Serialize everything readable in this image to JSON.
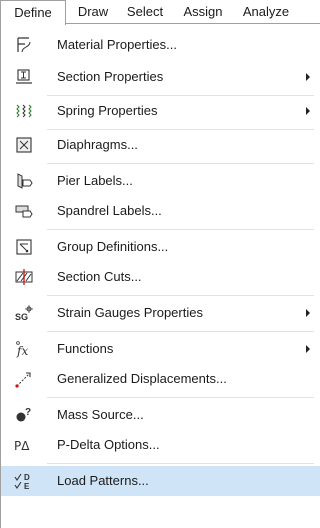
{
  "menubar": {
    "items": [
      {
        "label": "Define"
      },
      {
        "label": "Draw"
      },
      {
        "label": "Select"
      },
      {
        "label": "Assign"
      },
      {
        "label": "Analyze"
      }
    ]
  },
  "menu": {
    "items": [
      {
        "label": "Material Properties...",
        "icon": "material-properties-icon",
        "submenu": false
      },
      {
        "label": "Section Properties",
        "icon": "section-properties-icon",
        "submenu": true
      },
      {
        "label": "Spring Properties",
        "icon": "spring-properties-icon",
        "submenu": true
      },
      {
        "label": "Diaphragms...",
        "icon": "diaphragms-icon",
        "submenu": false
      },
      {
        "label": "Pier Labels...",
        "icon": "pier-labels-icon",
        "submenu": false
      },
      {
        "label": "Spandrel Labels...",
        "icon": "spandrel-labels-icon",
        "submenu": false
      },
      {
        "label": "Group Definitions...",
        "icon": "group-definitions-icon",
        "submenu": false
      },
      {
        "label": "Section Cuts...",
        "icon": "section-cuts-icon",
        "submenu": false
      },
      {
        "label": "Strain Gauges Properties",
        "icon": "strain-gauges-icon",
        "icon_text": "SG",
        "submenu": true
      },
      {
        "label": "Functions",
        "icon": "functions-icon",
        "icon_text": "fx",
        "submenu": true
      },
      {
        "label": "Generalized Displacements...",
        "icon": "generalized-displacements-icon",
        "submenu": false
      },
      {
        "label": "Mass Source...",
        "icon": "mass-source-icon",
        "icon_text": "?",
        "submenu": false
      },
      {
        "label": "P-Delta Options...",
        "icon": "p-delta-icon",
        "icon_text": "PΔ",
        "submenu": false
      },
      {
        "label": "Load Patterns...",
        "icon": "load-patterns-icon",
        "icon_text_top": "D",
        "icon_text_bottom": "E",
        "submenu": false,
        "highlighted": true
      }
    ]
  },
  "colors": {
    "highlight": "#cfe5f7",
    "border": "#a0a0a0",
    "separator": "#e2e2e2"
  }
}
